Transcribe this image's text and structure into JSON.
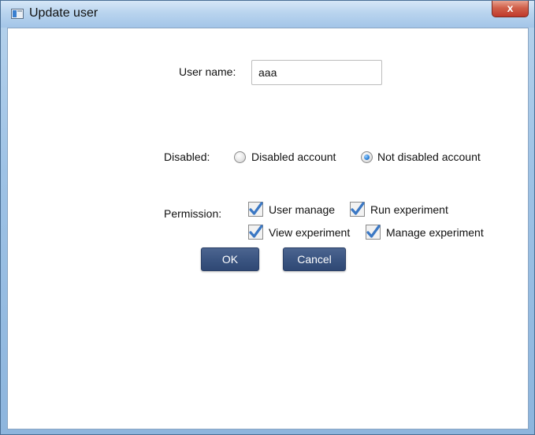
{
  "window": {
    "title": "Update user",
    "close_label": "x"
  },
  "form": {
    "username_label": "User name:",
    "username_value": "aaa",
    "disabled_label": "Disabled:",
    "disabled_options": [
      {
        "label": "Disabled account",
        "checked": false
      },
      {
        "label": "Not disabled account",
        "checked": true
      }
    ],
    "permission_label": "Permission:",
    "permissions": [
      {
        "label": "User manage",
        "checked": true
      },
      {
        "label": "Run experiment",
        "checked": true
      },
      {
        "label": "View experiment",
        "checked": true
      },
      {
        "label": "Manage experiment",
        "checked": true
      }
    ]
  },
  "buttons": {
    "ok_label": "OK",
    "cancel_label": "Cancel"
  },
  "colors": {
    "checkbox_check": "#3b78c4",
    "button_bg": "#3b5582",
    "radio_selected": "#2b7fd6"
  }
}
